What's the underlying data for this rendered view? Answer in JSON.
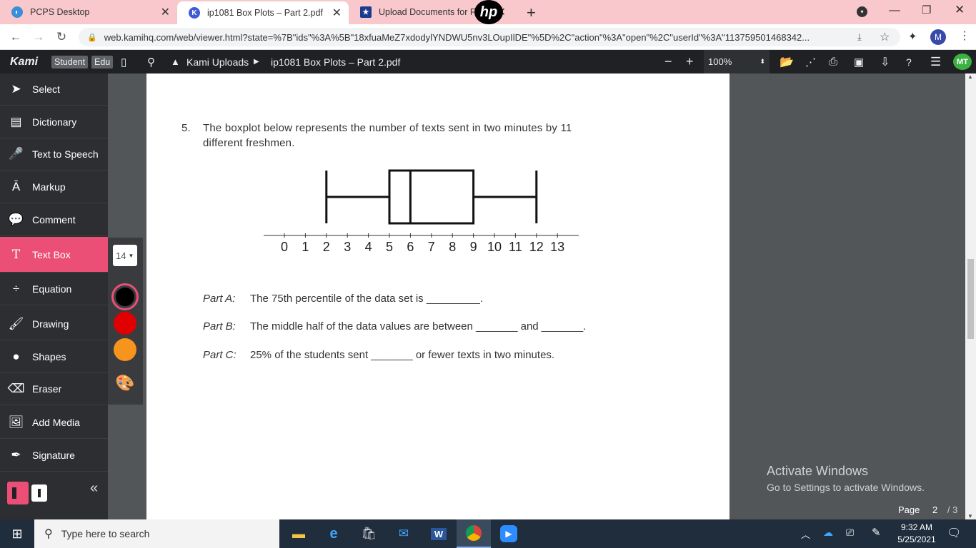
{
  "browser": {
    "tabs": [
      {
        "title": "PCPS Desktop",
        "icon": "pcps-icon"
      },
      {
        "title": "ip1081 Box Plots – Part 2.pdf",
        "icon": "kami-icon"
      },
      {
        "title": "Upload Documents for Fre",
        "icon": "star-icon"
      }
    ],
    "url": "web.kamihq.com/web/viewer.html?state=%7B\"ids\"%3A%5B\"18xfuaMeZ7xdodylYNDWU5nv3LOupIlDE\"%5D%2C\"action\"%3A\"open\"%2C\"userId\"%3A\"113759501468342...",
    "profile_initial": "M"
  },
  "kami": {
    "logo": "Kami",
    "badges": [
      "Student",
      "Edu"
    ],
    "breadcrumb_root": "Kami Uploads",
    "file_name": "ip1081 Box Plots – Part 2.pdf",
    "zoom": "100%",
    "user_initials": "MT"
  },
  "sidebar": {
    "items": [
      {
        "label": "Select",
        "icon": "cursor-icon"
      },
      {
        "label": "Dictionary",
        "icon": "book-icon"
      },
      {
        "label": "Text to Speech",
        "icon": "speech-icon"
      },
      {
        "label": "Markup",
        "icon": "highlighter-icon"
      },
      {
        "label": "Comment",
        "icon": "comment-icon"
      },
      {
        "label": "Text Box",
        "icon": "text-icon"
      },
      {
        "label": "Equation",
        "icon": "divide-icon"
      },
      {
        "label": "Drawing",
        "icon": "brush-icon"
      },
      {
        "label": "Shapes",
        "icon": "shapes-icon"
      },
      {
        "label": "Eraser",
        "icon": "eraser-icon"
      },
      {
        "label": "Add Media",
        "icon": "media-icon"
      },
      {
        "label": "Signature",
        "icon": "pen-icon"
      }
    ],
    "font_size": "14",
    "colors": [
      "#000000",
      "#e00000",
      "#f7941d"
    ]
  },
  "document": {
    "question_number": "5.",
    "question_line1": "The boxplot below represents the number of texts sent in two minutes by 11",
    "question_line2": "different freshmen.",
    "parts": [
      {
        "label": "Part A:",
        "text": "The 75th percentile of the data set is _________."
      },
      {
        "label": "Part B:",
        "text": "The middle half of the data values are between _______ and _______."
      },
      {
        "label": "Part C:",
        "text": "25% of the students sent _______ or fewer texts in two minutes."
      }
    ],
    "page_label": "Page",
    "page_current": "2",
    "page_total": "/ 3"
  },
  "chart_data": {
    "type": "boxplot",
    "axis_ticks": [
      0,
      1,
      2,
      3,
      4,
      5,
      6,
      7,
      8,
      9,
      10,
      11,
      12,
      13
    ],
    "min": 2,
    "q1": 5,
    "median": 6,
    "q3": 9,
    "max": 12,
    "xlim": [
      -1,
      14
    ]
  },
  "watermark": {
    "line1": "Activate Windows",
    "line2": "Go to Settings to activate Windows."
  },
  "taskbar": {
    "search_placeholder": "Type here to search",
    "time": "9:32 AM",
    "date": "5/25/2021"
  }
}
